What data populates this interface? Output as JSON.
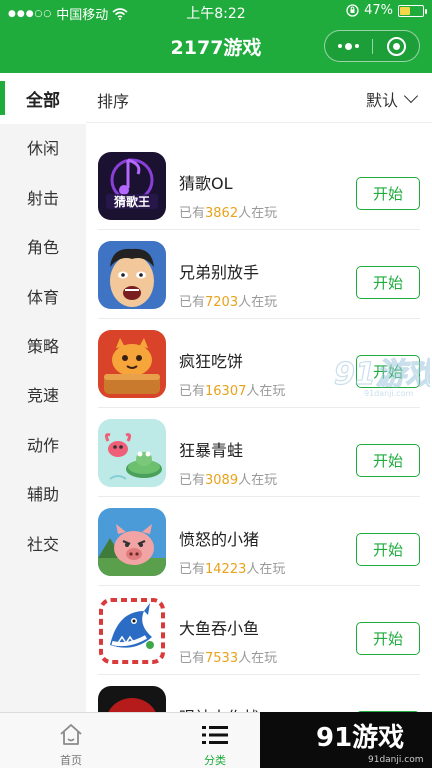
{
  "status_bar": {
    "carrier": "中国移动",
    "time": "上午8:22",
    "battery": "47%",
    "battery_level": 0.47
  },
  "header": {
    "title": "2177游戏"
  },
  "filter": {
    "all": "全部",
    "sort": "排序",
    "default": "默认"
  },
  "sidebar": {
    "items": [
      {
        "label": "休闲"
      },
      {
        "label": "射击"
      },
      {
        "label": "角色"
      },
      {
        "label": "体育"
      },
      {
        "label": "策略"
      },
      {
        "label": "竞速"
      },
      {
        "label": "动作"
      },
      {
        "label": "辅助"
      },
      {
        "label": "社交"
      }
    ]
  },
  "games": [
    {
      "name": "猜歌OL",
      "prefix": "已有",
      "count": "3862",
      "suffix": "人在玩",
      "button": "开始",
      "icon_text": "猜歌王"
    },
    {
      "name": "兄弟别放手",
      "prefix": "已有",
      "count": "7203",
      "suffix": "人在玩",
      "button": "开始"
    },
    {
      "name": "疯狂吃饼",
      "prefix": "已有",
      "count": "16307",
      "suffix": "人在玩",
      "button": "开始"
    },
    {
      "name": "狂暴青蛙",
      "prefix": "已有",
      "count": "3089",
      "suffix": "人在玩",
      "button": "开始"
    },
    {
      "name": "愤怒的小猪",
      "prefix": "已有",
      "count": "14223",
      "suffix": "人在玩",
      "button": "开始"
    },
    {
      "name": "大鱼吞小鱼",
      "prefix": "已有",
      "count": "7533",
      "suffix": "人在玩",
      "button": "开始"
    },
    {
      "name": "眼神大作战",
      "prefix": "已有",
      "count": "",
      "suffix": "",
      "button": "开始"
    }
  ],
  "tabbar": {
    "home": "首页",
    "category": "分类"
  },
  "watermark": {
    "logo": "91游戏",
    "url": "91danji.com"
  },
  "colors": {
    "brand_green": "#1fac3d",
    "count_orange": "#e8a21c"
  }
}
